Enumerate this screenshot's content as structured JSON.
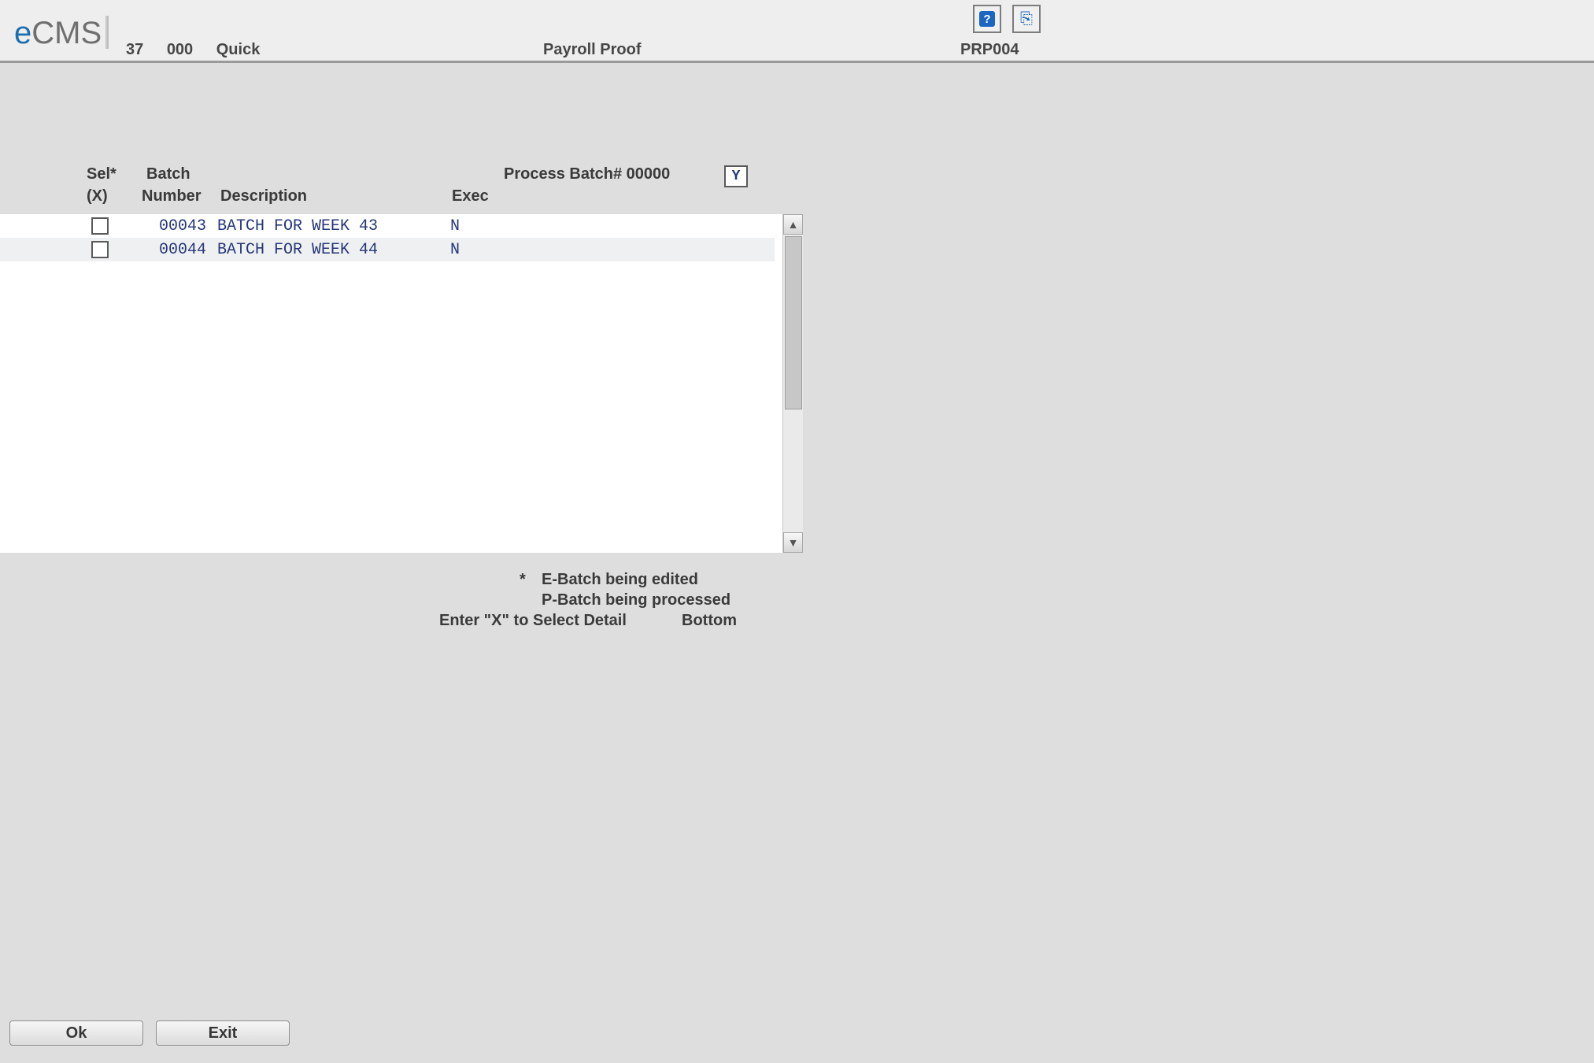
{
  "header": {
    "logo_prefix": "e",
    "logo_text": "CMS",
    "code_1": "37",
    "code_2": "000",
    "profile": "Quick",
    "title": "Payroll Proof",
    "screen_code": "PRP004"
  },
  "toolbar": {
    "help_label": "?",
    "export_glyph": "⎘"
  },
  "grid": {
    "headers": {
      "sel_top": "Sel*",
      "sel_bot": "(X)",
      "batch_top": "Batch",
      "batch_bot": "Number",
      "description": "Description",
      "process_batch": "Process Batch# 00000",
      "exec": "Exec"
    },
    "process_batch_value": "Y",
    "rows": [
      {
        "batch": "00043",
        "description": "BATCH FOR WEEK 43",
        "exec": "N"
      },
      {
        "batch": "00044",
        "description": "BATCH FOR WEEK 44",
        "exec": "N"
      }
    ]
  },
  "legend": {
    "star": "*",
    "line1": "E-Batch being edited",
    "line2": "P-Batch being processed",
    "enter_hint": "Enter \"X\" to Select Detail",
    "bottom": "Bottom"
  },
  "buttons": {
    "ok": "Ok",
    "exit": "Exit"
  }
}
